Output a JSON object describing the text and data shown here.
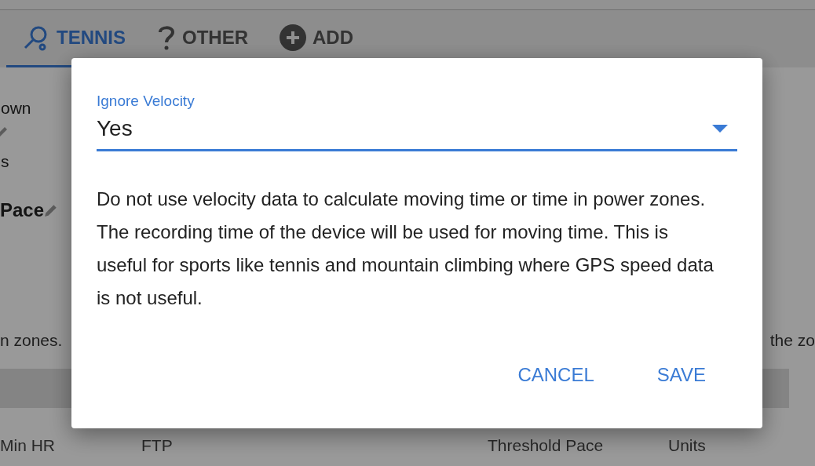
{
  "tabs": [
    {
      "label": "TENNIS",
      "selected": true
    },
    {
      "label": "OTHER",
      "selected": false
    },
    {
      "label": "ADD",
      "selected": false
    }
  ],
  "background": {
    "left_labels": [
      {
        "text": "own",
        "editable": true
      },
      {
        "text": "s",
        "editable": false
      }
    ],
    "left_value": {
      "text": "Pace",
      "editable": true
    },
    "note_left": "n zones.",
    "note_right": "the zo",
    "bottom_labels": [
      "Min HR",
      "FTP",
      "Threshold Pace",
      "Units"
    ]
  },
  "dialog": {
    "field": {
      "label": "Ignore Velocity",
      "value": "Yes"
    },
    "description": "Do not use velocity data to calculate moving time or time in power zones. The recording time of the device will be used for moving time. This is useful for sports like tennis and mountain climbing where GPS speed data is not useful.",
    "buttons": [
      "CANCEL",
      "SAVE"
    ]
  }
}
